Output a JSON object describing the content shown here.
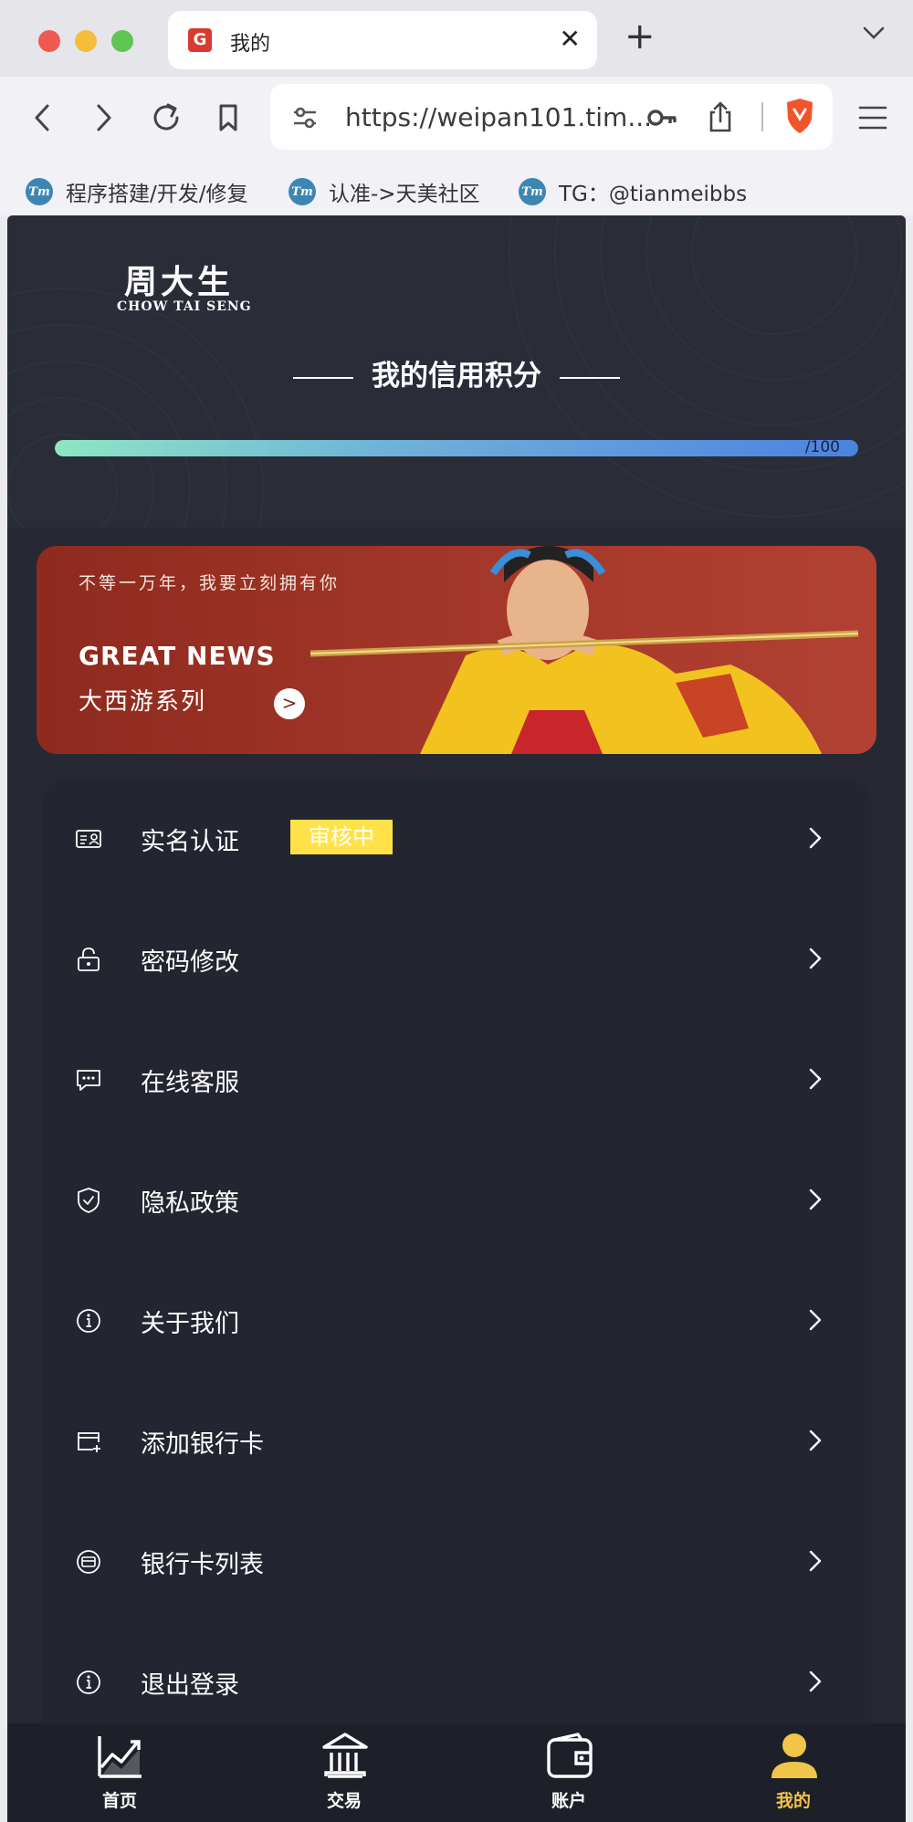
{
  "browser": {
    "tab_title": "我的",
    "url": "https://weipan101.tim...",
    "bookmarks": [
      "程序搭建/开发/修复",
      "认准->天美社区",
      "TG：@tianmeibbs"
    ]
  },
  "header": {
    "logo_cn": "周大生",
    "logo_en": "CHOW TAI SENG",
    "credit_title": "我的信用积分",
    "credit_label": "/100",
    "credit_value": 100
  },
  "banner": {
    "tagline": "不等一万年，我要立刻拥有你",
    "headline": "GREAT NEWS",
    "subtitle": "大西游系列",
    "go": ">"
  },
  "menu": [
    {
      "label": "实名认证",
      "badge": "审核中",
      "icon": "id-card-icon"
    },
    {
      "label": "密码修改",
      "icon": "lock-icon"
    },
    {
      "label": "在线客服",
      "icon": "chat-icon"
    },
    {
      "label": "隐私政策",
      "icon": "shield-icon"
    },
    {
      "label": "关于我们",
      "icon": "info-icon"
    },
    {
      "label": "添加银行卡",
      "icon": "add-card-icon"
    },
    {
      "label": "银行卡列表",
      "icon": "card-icon"
    },
    {
      "label": "退出登录",
      "icon": "info-icon"
    }
  ],
  "bottom_nav": [
    {
      "label": "首页",
      "active": false
    },
    {
      "label": "交易",
      "active": false
    },
    {
      "label": "账户",
      "active": false
    },
    {
      "label": "我的",
      "active": true
    }
  ],
  "colors": {
    "accent": "#ffe24a",
    "active_tab": "#f1c54a",
    "background": "#262833"
  }
}
